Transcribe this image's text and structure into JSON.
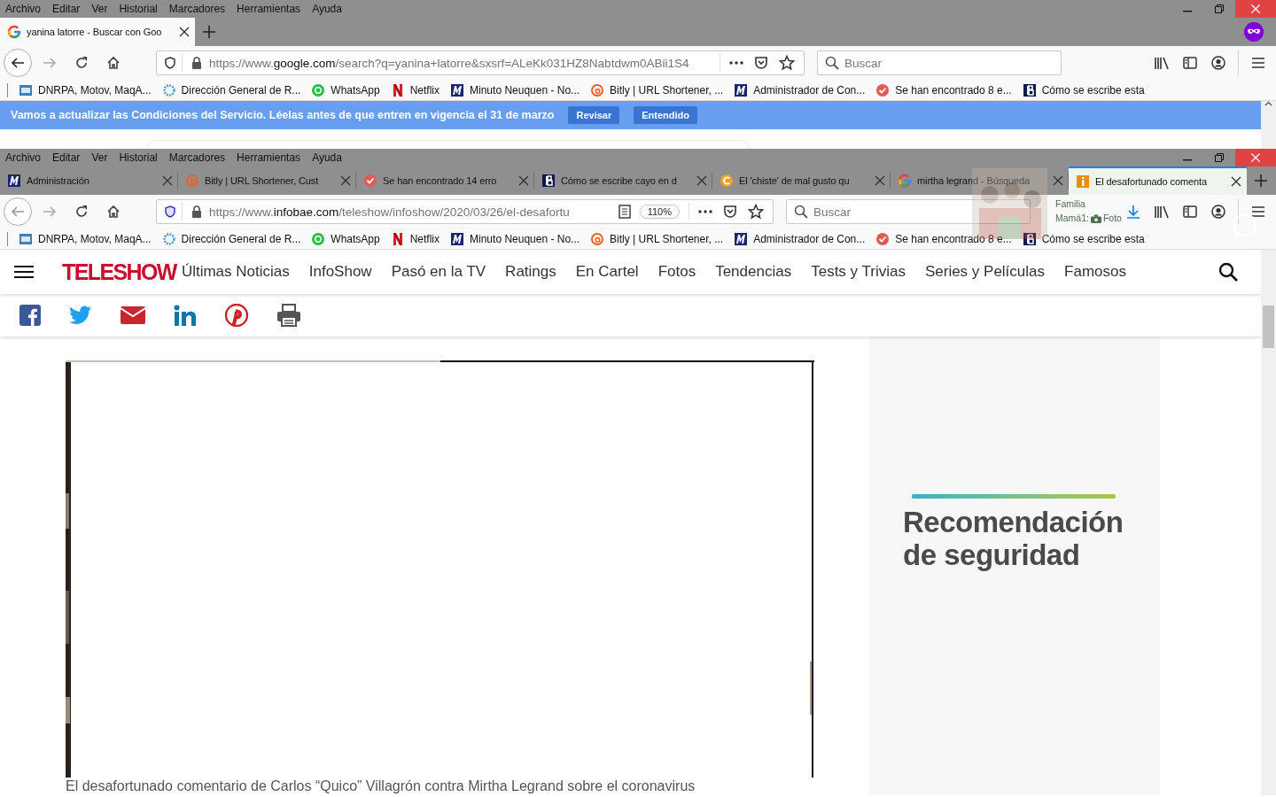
{
  "back_window": {
    "menu": [
      "Archivo",
      "Editar",
      "Ver",
      "Historial",
      "Marcadores",
      "Herramientas",
      "Ayuda"
    ],
    "tabs": [
      {
        "title": "yanina latorre - Buscar con Goo",
        "kind": "google",
        "selected": true
      }
    ],
    "address": {
      "scheme": "https://www.",
      "domain": "google.com",
      "path": "/search?q=yanina+latorre&sxsrf=ALeKk031HZ8Nabtdwm0ABii1S4"
    },
    "search": {
      "placeholder": "Buscar"
    },
    "bookmarks": [
      {
        "title": "DNRPA, Motov, MaqA...",
        "kind": "dnrpa"
      },
      {
        "title": "Dirección General de R...",
        "kind": "globe"
      },
      {
        "title": "WhatsApp",
        "kind": "whatsapp"
      },
      {
        "title": "Netflix",
        "kind": "netflix"
      },
      {
        "title": "Minuto Neuquen - No...",
        "kind": "m"
      },
      {
        "title": "Bitly | URL Shortener, ...",
        "kind": "bitly"
      },
      {
        "title": "Administrador de Con...",
        "kind": "m"
      },
      {
        "title": "Se han encontrado 8 e...",
        "kind": "check"
      },
      {
        "title": "Cómo se escribe esta",
        "kind": "b"
      }
    ],
    "notice": {
      "text": "Vamos a actualizar las Condiciones del Servicio. Léelas antes de que entren en vigencia el 31 de marzo",
      "buttons": [
        "Revisar",
        "Entendido"
      ]
    }
  },
  "front_window": {
    "menu": [
      "Archivo",
      "Editar",
      "Ver",
      "Historial",
      "Marcadores",
      "Herramientas",
      "Ayuda"
    ],
    "tabs": [
      {
        "title": "Administración",
        "kind": "m",
        "selected": false
      },
      {
        "title": "Bitly | URL Shortener, Cust",
        "kind": "bitly",
        "selected": false
      },
      {
        "title": "Se han encontrado 14 erro",
        "kind": "check",
        "selected": false
      },
      {
        "title": "Cómo se escribe cayo en d",
        "kind": "b",
        "selected": false
      },
      {
        "title": "El 'chiste' de mal gusto qu",
        "kind": "ccircle",
        "selected": false
      },
      {
        "title": "mirtha legrand - Búsqueda",
        "kind": "google",
        "selected": false
      },
      {
        "title": "El desafortunado comenta",
        "kind": "info",
        "selected": true
      }
    ],
    "address": {
      "scheme": "https://www.",
      "domain": "infobae.com",
      "path": "/teleshow/infoshow/2020/03/26/el-desafortu"
    },
    "zoom": "110%",
    "search": {
      "placeholder": "Buscar"
    },
    "bookmarks": [
      {
        "title": "DNRPA, Motov, MaqA...",
        "kind": "dnrpa"
      },
      {
        "title": "Dirección General de R...",
        "kind": "globe"
      },
      {
        "title": "WhatsApp",
        "kind": "whatsapp"
      },
      {
        "title": "Netflix",
        "kind": "netflix"
      },
      {
        "title": "Minuto Neuquen - No...",
        "kind": "m"
      },
      {
        "title": "Bitly | URL Shortener, ...",
        "kind": "bitly"
      },
      {
        "title": "Administrador de Con...",
        "kind": "m"
      },
      {
        "title": "Se han encontrado 8 e...",
        "kind": "check"
      },
      {
        "title": "Cómo se escribe esta",
        "kind": "b"
      }
    ],
    "notification": {
      "title": "Familia",
      "sender": "Mamá1:",
      "message": "Foto"
    }
  },
  "page": {
    "logo": "TELESHOW",
    "nav": [
      "Últimas Noticias",
      "InfoShow",
      "Pasó en la TV",
      "Ratings",
      "En Cartel",
      "Fotos",
      "Tendencias",
      "Tests y Trivias",
      "Series y Películas",
      "Famosos"
    ],
    "caption": "El desafortunado comentario de Carlos “Quico” Villagrón contra Mirtha Legrand sobre el coronavirus",
    "ad": {
      "lines": [
        "Recomendación",
        "de seguridad"
      ]
    }
  }
}
